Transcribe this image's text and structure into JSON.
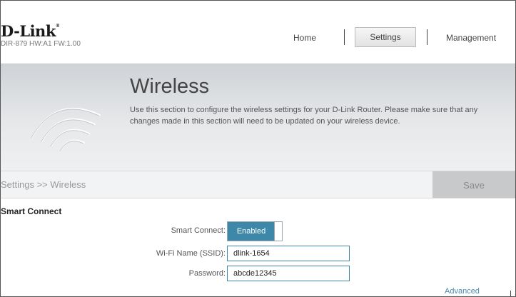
{
  "header": {
    "brand": "D-Link",
    "brand_mark": "®",
    "model_info": "DIR-879 HW:A1 FW:1.00",
    "nav": {
      "home": "Home",
      "settings": "Settings",
      "management": "Management"
    }
  },
  "banner": {
    "title": "Wireless",
    "description": "Use this section to configure the wireless settings for your D-Link Router. Please make sure that any changes made in this section will need to be updated on your wireless device.",
    "icon": "wifi-icon"
  },
  "breadcrumb": {
    "path": "Settings >> Wireless",
    "save_label": "Save"
  },
  "smart_connect": {
    "section_title": "Smart Connect",
    "toggle_label": "Smart Connect:",
    "toggle_value": "Enabled",
    "ssid_label": "Wi-Fi Name (SSID):",
    "ssid_value": "dlink-1654",
    "password_label": "Password:",
    "password_value": "abcde12345"
  },
  "footer": {
    "advanced_link": "Advanced Settings..."
  },
  "colors": {
    "accent": "#3d88a8",
    "link": "#4a8ab0",
    "save_disabled": "#c8c9ca"
  }
}
